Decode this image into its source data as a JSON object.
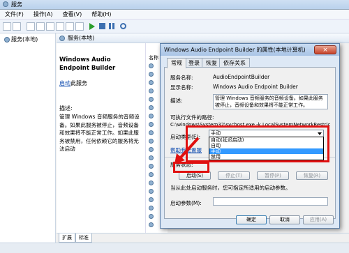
{
  "window": {
    "title": "服务"
  },
  "menu": [
    "文件(F)",
    "操作(A)",
    "查看(V)",
    "帮助(H)"
  ],
  "tree": {
    "item": "服务(本地)"
  },
  "header": {
    "title": "服务(本地)"
  },
  "detail": {
    "service_name": "Windows Audio Endpoint Builder",
    "start_link": "启动",
    "start_suffix": "此服务",
    "desc_label": "描述:",
    "desc_text": "管理 Windows 音频服务的音频设备。如果此服务被停止，音频设备和效果将不能正常工作。如果此服务被禁用，任何依赖它的服务将无法启动"
  },
  "list_header": "名称",
  "bottom_tabs": [
    "扩展",
    "标准"
  ],
  "dialog": {
    "title": "Windows Audio Endpoint Builder 的属性(本地计算机)",
    "close": "×",
    "tabs": [
      "常规",
      "登录",
      "恢复",
      "依存关系"
    ],
    "service_name_label": "服务名称:",
    "service_name_value": "AudioEndpointBuilder",
    "display_name_label": "显示名称:",
    "display_name_value": "Windows Audio Endpoint Builder",
    "desc_label": "描述:",
    "desc_value": "管理 Windows 音频服务的音频设备。如果此服务被停止，音频设备和效果将不能正常工作。",
    "path_label": "可执行文件的路径:",
    "path_value": "C:\\windows\\System32\\svchost.exe -k LocalSystemNetworkRestric",
    "startup_label": "启动类型(E):",
    "startup_value": "手动",
    "startup_options": [
      "自动(延迟启动)",
      "自动",
      "手动",
      "禁用"
    ],
    "startup_selected_index": 2,
    "help_link": "帮助我配置服",
    "status_label": "服务状态:",
    "buttons": {
      "start": "启动(S)",
      "stop": "停止(T)",
      "pause": "暂停(P)",
      "resume": "恢复(R)"
    },
    "hint": "当从此处启动服务时，您可指定所适用的启动参数。",
    "params_label": "启动参数(M):",
    "ok": "确定",
    "cancel": "取消",
    "apply": "应用(A)"
  },
  "colors": {
    "highlight": "#e01010",
    "selection": "#3399ff"
  }
}
